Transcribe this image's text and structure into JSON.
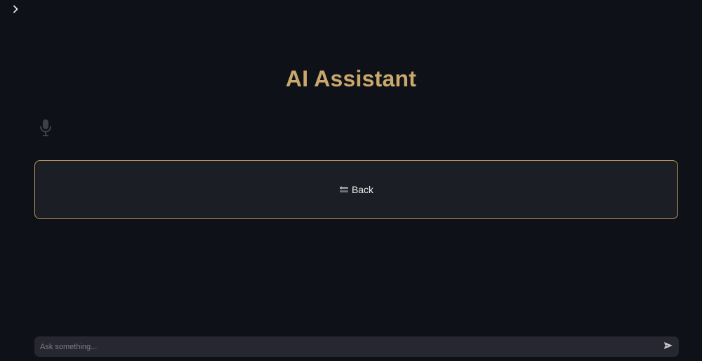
{
  "sidebar": {
    "toggle_icon": "chevron-right-icon"
  },
  "header": {
    "title": "AI Assistant"
  },
  "voice": {
    "icon": "microphone-icon"
  },
  "back_button": {
    "icon": "back-icon",
    "label": "Back"
  },
  "chat": {
    "placeholder": "Ask something...",
    "value": "",
    "send_icon": "send-icon"
  },
  "colors": {
    "background": "#0e1117",
    "accent": "#c9a76d",
    "button_border": "#b8945d",
    "button_bg": "#1b1e24",
    "input_bg": "#262730"
  }
}
